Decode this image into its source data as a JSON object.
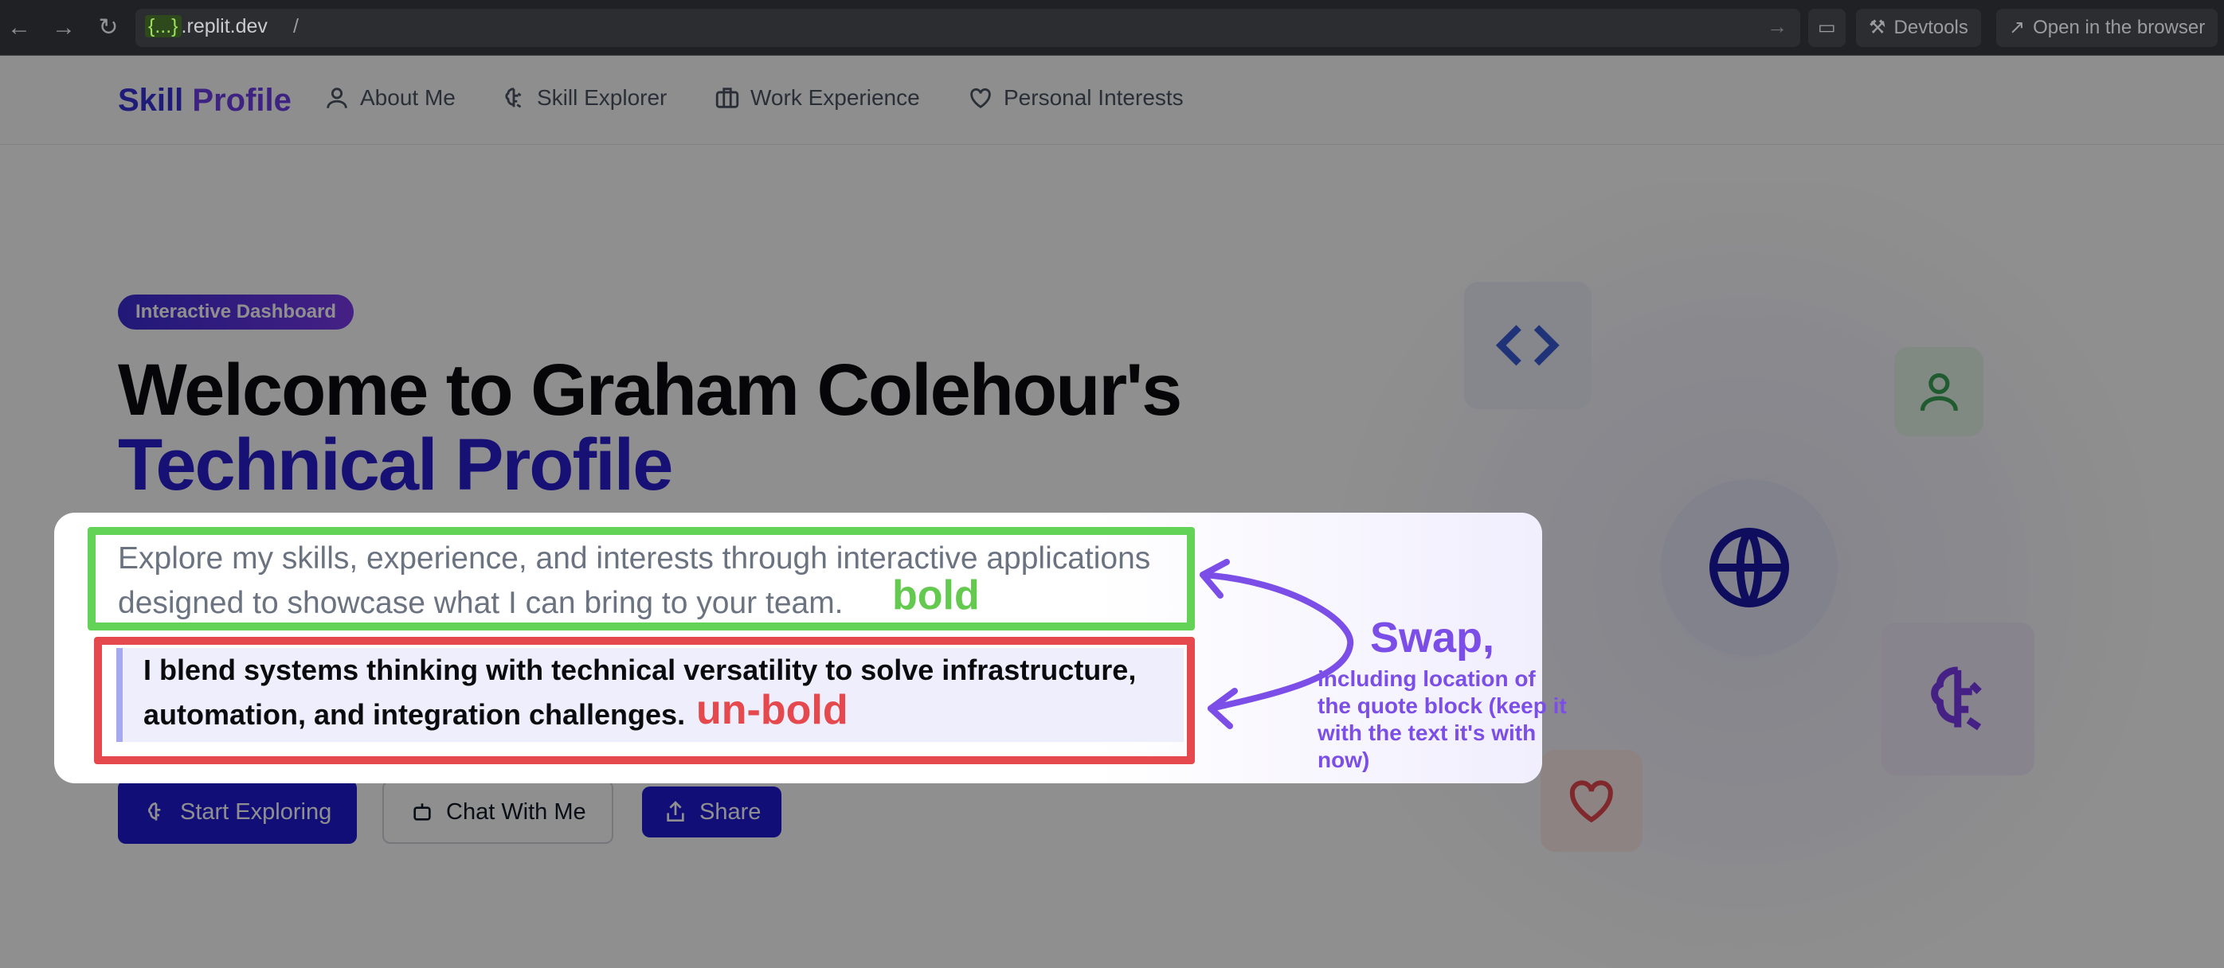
{
  "browser": {
    "url_host_badge": "{...}",
    "url_host_rest": ".replit.dev",
    "url_path": "/",
    "devtools_label": "Devtools",
    "open_browser_label": "Open in the browser"
  },
  "nav": {
    "brand_part1": "Skill ",
    "brand_part2": "Profile",
    "links": [
      {
        "label": "About Me",
        "icon": "user-icon"
      },
      {
        "label": "Skill Explorer",
        "icon": "brain-icon"
      },
      {
        "label": "Work Experience",
        "icon": "briefcase-icon"
      },
      {
        "label": "Personal Interests",
        "icon": "heart-icon"
      }
    ]
  },
  "hero": {
    "badge": "Interactive Dashboard",
    "title_line1": "Welcome to Graham Colehour's",
    "title_line2": "Technical Profile",
    "lead": "Explore my skills, experience, and interests through interactive applications designed to showcase what I can bring to your team.",
    "quote": "I blend systems thinking with technical versatility to solve infrastructure, automation, and integration challenges."
  },
  "buttons": {
    "start": "Start Exploring",
    "chat": "Chat With Me",
    "share": "Share"
  },
  "annotations": {
    "bold": "bold",
    "unbold": "un-bold",
    "swap": "Swap,",
    "swap_note": "including location of the quote block (keep it with the text it's with now)"
  },
  "colors": {
    "accent": "#2c1fd0",
    "annotation_green": "#63d357",
    "annotation_red": "#e5484d",
    "annotation_purple": "#7c4ee8"
  },
  "decor_icons": [
    "code-icon",
    "user-icon",
    "globe-icon",
    "brain-icon",
    "heart-icon"
  ]
}
